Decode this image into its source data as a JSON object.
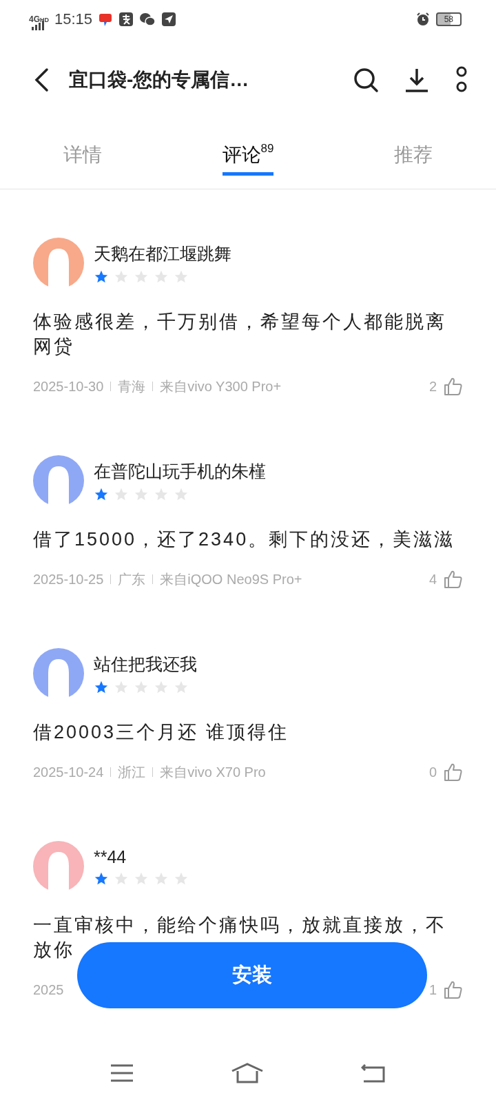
{
  "status_bar": {
    "network": "4G",
    "hd": "HD",
    "time": "15:15",
    "battery": "58"
  },
  "header": {
    "title": "宜口袋-您的专属信…"
  },
  "tabs": [
    {
      "label": "详情",
      "selected": false
    },
    {
      "label": "评论",
      "badge": "89",
      "selected": true
    },
    {
      "label": "推荐",
      "selected": false
    }
  ],
  "reviews": [
    {
      "name": "天鹅在都江堰跳舞",
      "stars": 1,
      "color": "#f7a98a",
      "text": "体验感很差，千万别借，希望每个人都能脱离网贷",
      "date": "2025-10-30",
      "region": "青海",
      "device": "来自vivo Y300 Pro+",
      "likes": "2"
    },
    {
      "name": "在普陀山玩手机的朱槿",
      "stars": 1,
      "color": "#8fa8f5",
      "text": "借了15000，还了2340。剩下的没还，美滋滋",
      "date": "2025-10-25",
      "region": "广东",
      "device": "来自iQOO Neo9S Pro+",
      "likes": "4"
    },
    {
      "name": "站住把我还我",
      "stars": 1,
      "color": "#8fa8f5",
      "text": "借20003三个月还  谁顶得住",
      "date": "2025-10-24",
      "region": "浙江",
      "device": "来自vivo X70 Pro",
      "likes": "0"
    },
    {
      "name": "**44",
      "stars": 1,
      "color": "#f8b4b8",
      "text": "一直审核中，能给个痛快吗，放就直接放，不放你",
      "date": "2025",
      "likes": "1"
    }
  ],
  "install_button": {
    "label": "安装"
  }
}
